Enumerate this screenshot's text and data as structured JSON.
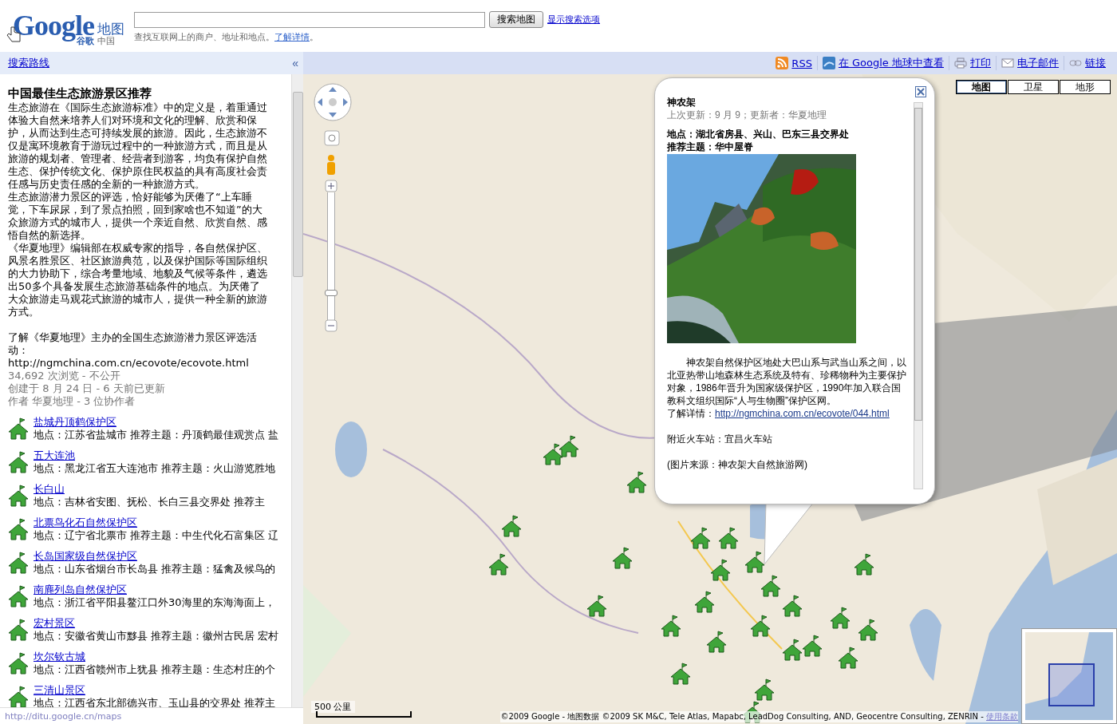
{
  "header": {
    "logo": {
      "brand": "Google",
      "brand_cn": "谷歌",
      "product": "地图",
      "region": "中国"
    },
    "search": {
      "button": "搜索地图",
      "options_link": "显示搜索选项"
    },
    "hint": {
      "before": "查找互联网上的商户、地址和地点。",
      "link": "了解详情",
      "after": "。"
    }
  },
  "sidebar_bar": {
    "directions_link": "搜索路线",
    "collapse": "«"
  },
  "toolbar": [
    {
      "kind": "rss",
      "label": "RSS"
    },
    {
      "kind": "earth",
      "label": "在 Google 地球中查看"
    },
    {
      "kind": "print",
      "label": "打印"
    },
    {
      "kind": "mail",
      "label": "电子邮件"
    },
    {
      "kind": "link",
      "label": "链接"
    }
  ],
  "sidebar": {
    "title": "中国最佳生态旅游景区推荐",
    "paragraphs": [
      "生态旅游在《国际生态旅游标准》中的定义是，着重通过体验大自然来培养人们对环境和文化的理解、欣赏和保护，从而达到生态可持续发展的旅游。因此，生态旅游不仅是寓环境教育于游玩过程中的一种旅游方式，而且是从旅游的规划者、管理者、经营者到游客，均负有保护自然生态、保护传统文化、保护原住民权益的具有高度社会责任感与历史责任感的全新的一种旅游方式。",
      "生态旅游潜力景区的评选，恰好能够为厌倦了“上车睡觉，下车尿尿，到了景点拍照，回到家啥也不知道”的大众旅游方式的城市人，提供一个亲近自然、欣赏自然、感悟自然的新选择。",
      "《华夏地理》编辑部在权威专家的指导，各自然保护区、风景名胜景区、社区旅游典范，以及保护国际等国际组织的大力协助下，综合考量地域、地貌及气候等条件，遴选出50多个具备发展生态旅游基础条件的地点。为厌倦了大众旅游走马观花式旅游的城市人，提供一种全新的旅游方式。"
    ],
    "more": "了解《华夏地理》主办的全国生态旅游潜力景区评选活动：http://ngmchina.com.cn/ecovote/ecovote.html",
    "meta": [
      "34,692 次浏览 - 不公开",
      "创建于 8 月 24 日 - 6 天前已更新",
      "作者 华夏地理 - 3 位协作者"
    ],
    "places": [
      {
        "name": "盐城丹顶鹤保护区",
        "detail": "地点：江苏省盐城市 推荐主题：丹顶鹤最佳观赏点 盐"
      },
      {
        "name": "五大连池",
        "detail": "地点：黑龙江省五大连池市 推荐主题：火山游览胜地"
      },
      {
        "name": "长白山",
        "detail": "地点：吉林省安图、抚松、长白三县交界处 推荐主"
      },
      {
        "name": "北票鸟化石自然保护区",
        "detail": "地点：辽宁省北票市 推荐主题：中生代化石富集区 辽"
      },
      {
        "name": "长岛国家级自然保护区",
        "detail": "地点：山东省烟台市长岛县 推荐主题：猛禽及候鸟的"
      },
      {
        "name": "南麂列岛自然保护区",
        "detail": "地点：浙江省平阳县鳌江口外30海里的东海海面上，"
      },
      {
        "name": "宏村景区",
        "detail": "地点：安徽省黄山市黟县 推荐主题：徽州古民居 宏村"
      },
      {
        "name": "坎尔钦古城",
        "detail": "地点：江西省赣州市上犹县 推荐主题：生态村庄的个"
      },
      {
        "name": "三清山景区",
        "detail": "地点：江西省东北部德兴市、玉山县的交界处 推荐主"
      }
    ]
  },
  "status_bar": "http://ditu.google.cn/maps",
  "map": {
    "zoom": {
      "level": 0.2
    },
    "map_types": [
      {
        "label": "地图",
        "selected": true
      },
      {
        "label": "卫星",
        "selected": false
      },
      {
        "label": "地形",
        "selected": false
      }
    ],
    "scale": "500 公里",
    "copyright": {
      "text": "©2009 Google - 地图数据 ©2009 SK M&C, Tele Atlas, Mapabc, LeadDog Consulting, AND, Geocentre Consulting, ZENRIN -",
      "link": "使用条款"
    },
    "info_window": {
      "title": "神农架",
      "updated": "上次更新：9 月 9；更新者：华夏地理",
      "facts": [
        "地点：湖北省房县、兴山、巴东三县交界处",
        "推荐主题：华中屋脊"
      ],
      "description": "神农架自然保护区地处大巴山系与武当山系之间，以北亚热带山地森林生态系统及特有、珍稀物种为主要保护对象，1986年晋升为国家级保护区，1990年加入联合国教科文组织国际“人与生物圈”保护区网。",
      "more_label": "了解详情：",
      "more_link": "http://ngmchina.com.cn/ecovote/044.html",
      "station": "附近火车站：宜昌火车站",
      "source": "(图片来源：神农架大自然旅游网)"
    }
  }
}
